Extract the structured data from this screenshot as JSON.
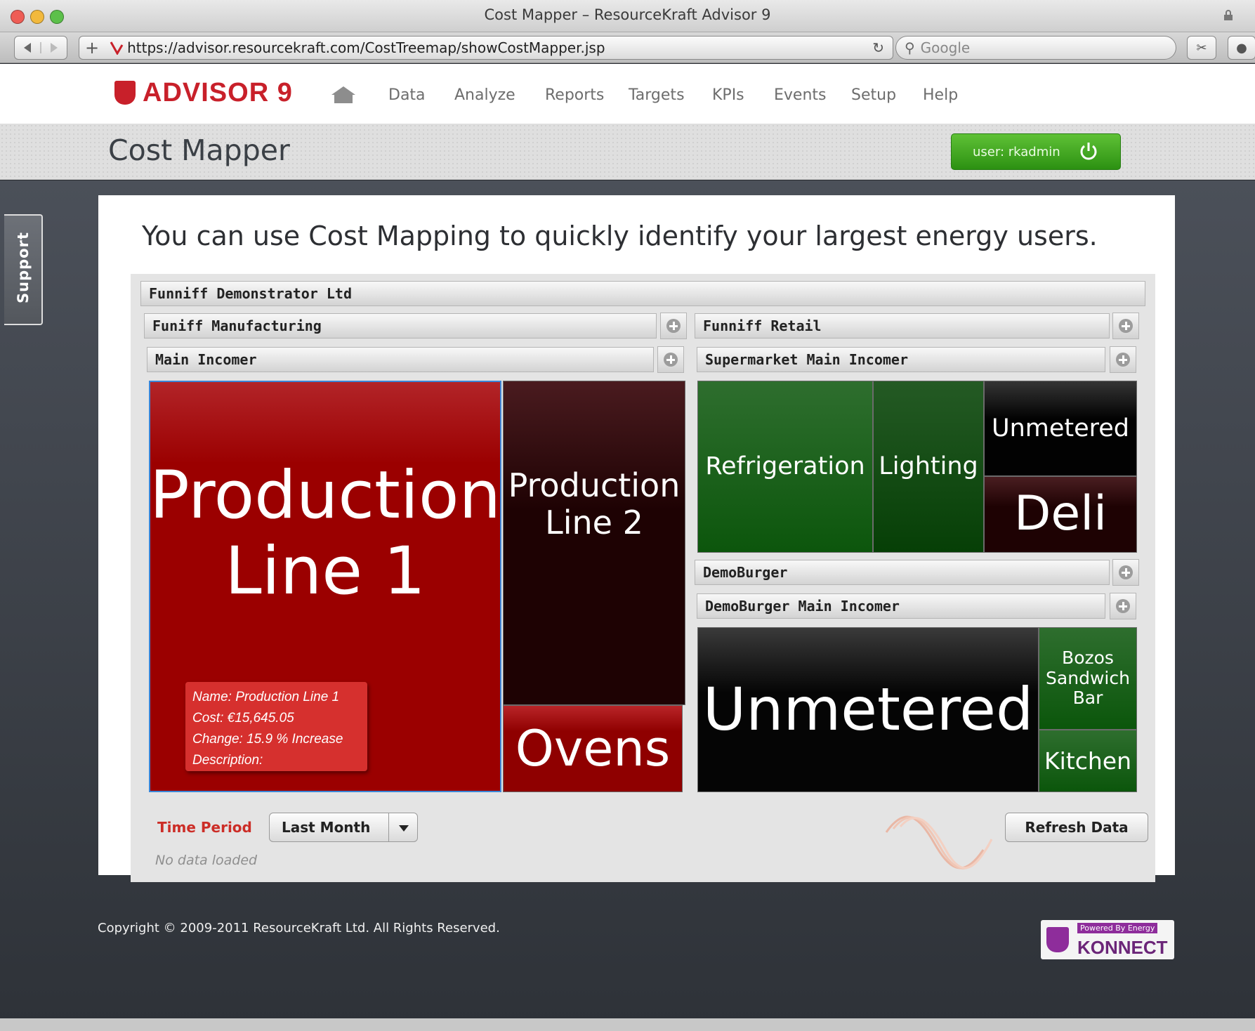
{
  "browser": {
    "window_title": "Cost Mapper – ResourceKraft Advisor 9",
    "url": "https://advisor.resourcekraft.com/CostTreemap/showCostMapper.jsp",
    "search_placeholder": "Google"
  },
  "header": {
    "logo_text": "ADVISOR 9",
    "nav": [
      "Data",
      "Analyze",
      "Reports",
      "Targets",
      "KPIs",
      "Events",
      "Setup",
      "Help"
    ]
  },
  "subheader": {
    "page_title": "Cost Mapper",
    "user_label": "user: rkadmin"
  },
  "sidebar": {
    "support_label": "Support"
  },
  "intro": {
    "headline": "You can use Cost Mapping to quickly identify your largest energy users."
  },
  "treemap": {
    "root": "Funniff Demonstrator Ltd",
    "manufacturing": {
      "name": "Funiff Manufacturing",
      "incomer": "Main Incomer",
      "cells": [
        "Production\nLine 1",
        "Production\nLine 2",
        "Ovens"
      ]
    },
    "retail": {
      "name": "Funniff Retail",
      "incomer": "Supermarket Main Incomer",
      "cells": [
        "Refrigeration",
        "Lighting",
        "Unmetered",
        "Deli"
      ]
    },
    "demoburger": {
      "name": "DemoBurger",
      "incomer": "DemoBurger Main Incomer",
      "cells": [
        "Unmetered",
        "Bozos\nSandwich\nBar",
        "Kitchen"
      ]
    },
    "colors": {
      "red_cell": "#9b0000",
      "dark_red_cell": "#2a0305",
      "green_cell": "#1f6e1f",
      "black_cell": "#050505"
    }
  },
  "tooltip": {
    "name": "Name: Production Line 1",
    "cost": "Cost: €15,645.05",
    "change": "Change: 15.9 % Increase",
    "description": "Description:"
  },
  "controls": {
    "time_period_label": "Time Period",
    "time_period_value": "Last Month",
    "status": "No data loaded",
    "refresh_label": "Refresh Data"
  },
  "footer": {
    "copyright": "Copyright © 2009-2011 ResourceKraft Ltd. All Rights Reserved.",
    "badge_top": "Powered By Energy",
    "badge_main": "KONNECT"
  }
}
